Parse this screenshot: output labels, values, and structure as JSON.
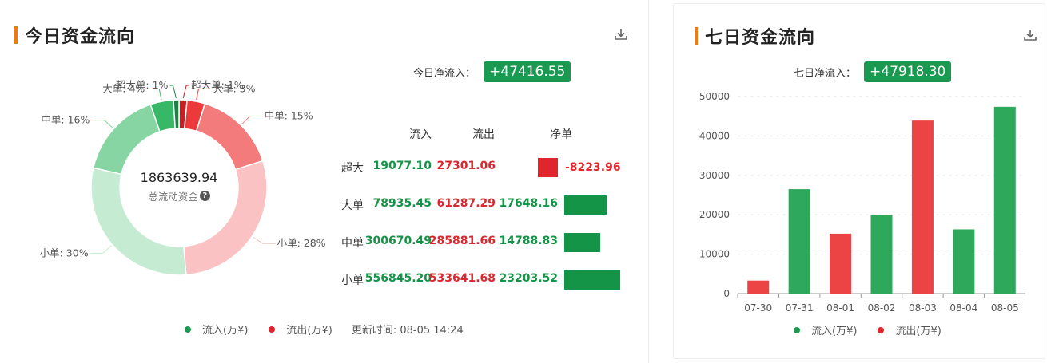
{
  "today": {
    "title": "今日资金流向",
    "net_label": "今日净流入：",
    "net_value": "+47416.55",
    "center_value": "1863639.94",
    "center_label": "总流动资金",
    "legend_in": "流入(万¥)",
    "legend_out": "流出(万¥)",
    "updated": "更新时间: 08-05 14:24",
    "table_headers": {
      "in": "流入",
      "out": "流出",
      "net": "净单"
    },
    "rows": [
      {
        "label": "超大",
        "in": "19077.10",
        "out": "27301.06",
        "net": "-8223.96",
        "net_num": -8223.96
      },
      {
        "label": "大单",
        "in": "78935.45",
        "out": "61287.29",
        "net": "17648.16",
        "net_num": 17648.16
      },
      {
        "label": "中单",
        "in": "300670.49",
        "out": "285881.66",
        "net": "14788.83",
        "net_num": 14788.83
      },
      {
        "label": "小单",
        "in": "556845.20",
        "out": "533641.68",
        "net": "23203.52",
        "net_num": 23203.52
      }
    ]
  },
  "week": {
    "title": "七日资金流向",
    "net_label": "七日净流入：",
    "net_value": "+47918.30",
    "legend_in": "流入(万¥)",
    "legend_out": "流出(万¥)"
  },
  "colors": {
    "inflow": "#2ea85a",
    "outflow": "#ec4444",
    "badge": "#1a9a50",
    "title_bar": "#f07a10"
  },
  "chart_data": [
    {
      "type": "pie",
      "title": "今日资金流向",
      "slices": [
        {
          "label": "超大单: 1%",
          "value": 27301.06,
          "side": "out",
          "color": "#c42026"
        },
        {
          "label": "大单: 3%",
          "value": 61287.29,
          "side": "out",
          "color": "#ec3a3a"
        },
        {
          "label": "中单: 15%",
          "value": 285881.66,
          "side": "out",
          "color": "#f47b7b"
        },
        {
          "label": "小单: 28%",
          "value": 533641.68,
          "side": "out",
          "color": "#fac2c2"
        },
        {
          "label": "小单: 30%",
          "value": 556845.2,
          "side": "in",
          "color": "#c5ebd3"
        },
        {
          "label": "中单: 16%",
          "value": 300670.49,
          "side": "in",
          "color": "#86d5a2"
        },
        {
          "label": "大单: 4%",
          "value": 78935.45,
          "side": "in",
          "color": "#36b866"
        },
        {
          "label": "超大单: 1%",
          "value": 19077.1,
          "side": "in",
          "color": "#1d8146"
        }
      ]
    },
    {
      "type": "bar",
      "title": "七日资金流向",
      "categories": [
        "07-30",
        "07-31",
        "08-01",
        "08-02",
        "08-03",
        "08-04",
        "08-05"
      ],
      "values": [
        3300,
        26500,
        15200,
        20000,
        43900,
        16300,
        47400
      ],
      "direction": [
        "out",
        "in",
        "out",
        "in",
        "out",
        "in",
        "in"
      ],
      "ylim": [
        0,
        50000
      ],
      "yticks": [
        "0",
        "10000",
        "20000",
        "30000",
        "40000",
        "50000"
      ],
      "grid": true
    }
  ]
}
